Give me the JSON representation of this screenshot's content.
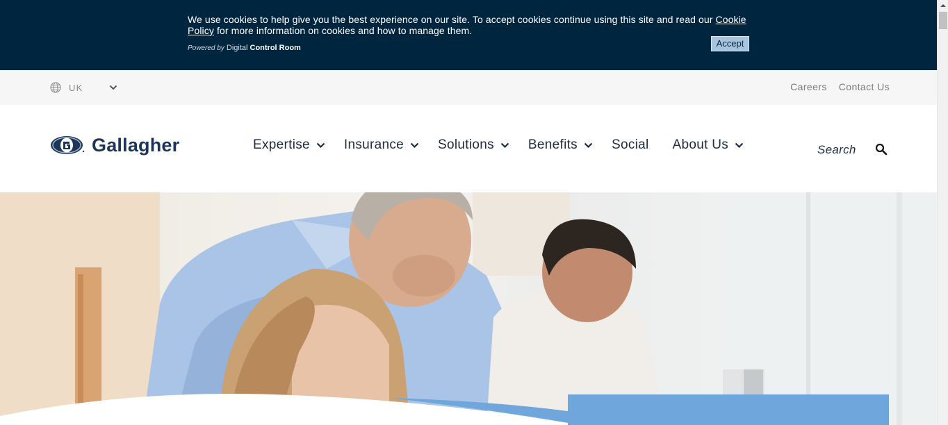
{
  "cookie_banner": {
    "message_before_link": "We use cookies to help give you the best experience on our site. To accept cookies continue using this site and read our ",
    "link_text": "Cookie Policy",
    "message_after_link": " for more information on cookies and how to manage them.",
    "powered_by_prefix": "Powered by",
    "powered_by_brand": "Digital",
    "powered_by_product": "Control Room",
    "accept_label": "Accept",
    "background_color": "#00253e"
  },
  "utility_bar": {
    "region_icon": "globe-icon",
    "region_label": "UK",
    "region_chevron_icon": "chevron-down-icon",
    "links": [
      {
        "label": "Careers"
      },
      {
        "label": "Contact Us"
      }
    ]
  },
  "header": {
    "logo_text": "Gallagher",
    "nav": [
      {
        "label": "Expertise",
        "has_dropdown": true
      },
      {
        "label": "Insurance",
        "has_dropdown": true
      },
      {
        "label": "Solutions",
        "has_dropdown": true
      },
      {
        "label": "Benefits",
        "has_dropdown": true
      },
      {
        "label": "Social",
        "has_dropdown": false
      },
      {
        "label": "About Us",
        "has_dropdown": true
      }
    ],
    "search_placeholder": "Search",
    "search_icon": "search-icon"
  },
  "colors": {
    "brand_navy": "#1d3557",
    "hero_card_blue": "#6fa7dc"
  }
}
